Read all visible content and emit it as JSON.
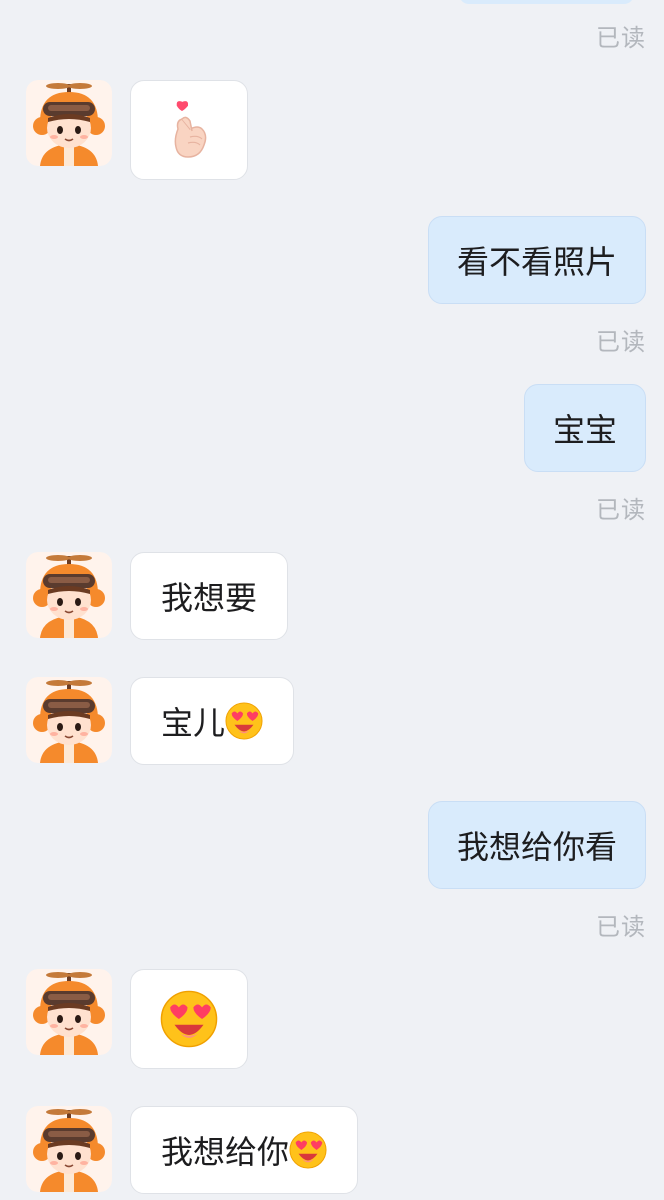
{
  "messages": {
    "read_label": "已读",
    "out_1": "看不看照片",
    "out_2": "宝宝",
    "in_1": "我想要",
    "in_2": "宝儿",
    "out_3": "我想给你看",
    "in_3": "我想给你"
  },
  "icons": {
    "heart_hand": "finger-heart-emoji",
    "heart_eyes": "heart-eyes-emoji",
    "avatar": "propeller-boy-avatar"
  },
  "colors": {
    "background": "#eff1f5",
    "outgoing_bubble": "#d9ebfc",
    "incoming_bubble": "#ffffff",
    "read_text": "#b3b7bd"
  }
}
